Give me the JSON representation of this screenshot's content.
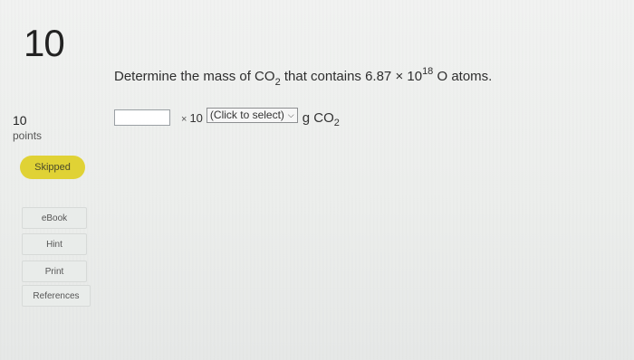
{
  "question_header": {
    "number": "10",
    "points_value": "10",
    "points_label": "points",
    "status": "Skipped"
  },
  "resources": {
    "ebook": "eBook",
    "hint": "Hint",
    "print": "Print",
    "references": "References"
  },
  "question": {
    "prefix": "Determine the mass of CO",
    "subscript1": "2",
    "middle": " that contains 6.87 × 10",
    "exponent": "18",
    "suffix": " O atoms."
  },
  "answer": {
    "input_value": "",
    "times_symbol": "×",
    "ten": "10",
    "exponent_select": "(Click to select)",
    "unit_prefix": "g CO",
    "unit_subscript": "2"
  },
  "colors": {
    "status_badge": "#e0d235",
    "background": "#eceeec"
  }
}
